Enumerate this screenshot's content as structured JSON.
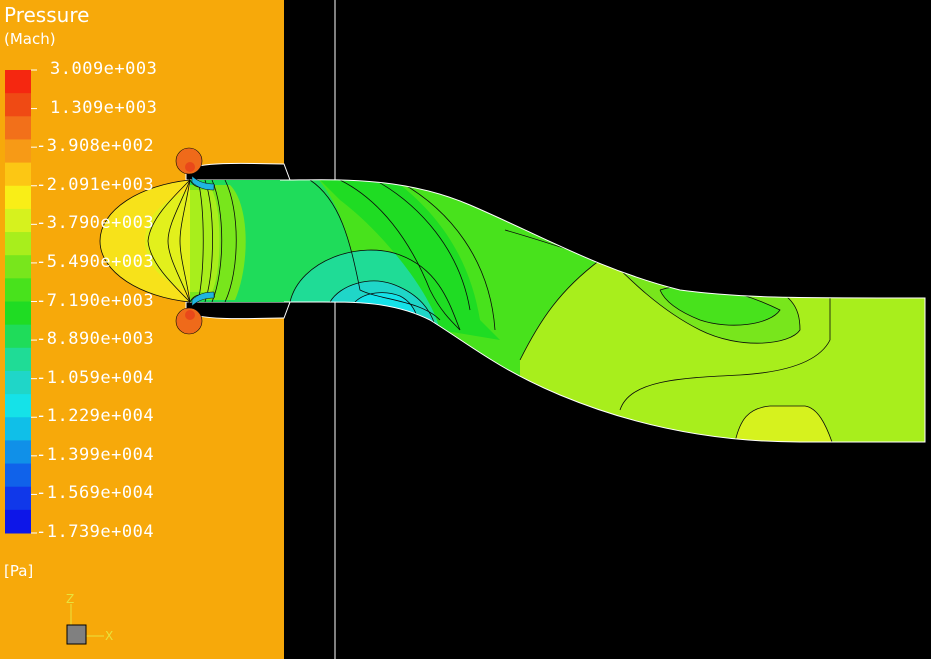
{
  "legend": {
    "title": "Pressure",
    "subtitle": "(Mach)",
    "unit": "[Pa]",
    "tick_labels": [
      "3.009e+003",
      "1.309e+003",
      "-3.908e+002",
      "-2.091e+003",
      "-3.790e+003",
      "-5.490e+003",
      "-7.190e+003",
      "-8.890e+003",
      "-1.059e+004",
      "-1.229e+004",
      "-1.399e+004",
      "-1.569e+004",
      "-1.739e+004"
    ],
    "colors": [
      "#f52710",
      "#ef4a14",
      "#f2701a",
      "#f79a16",
      "#fcc714",
      "#f9ee17",
      "#d6f21e",
      "#a8ee1c",
      "#78e61c",
      "#48e21c",
      "#1fdc23",
      "#1fdc5a",
      "#1fdc96",
      "#1fd6c8",
      "#15e2e8",
      "#10bfe8",
      "#1090e8",
      "#1062ea",
      "#1038ea",
      "#0d16e8"
    ]
  },
  "axes": {
    "z_label": "Z",
    "x_label": "X"
  },
  "colors": {
    "background": "#000000",
    "backdrop": "#f7a90a",
    "outline": "#ffffff",
    "contour_line": "#0a0a0a"
  }
}
